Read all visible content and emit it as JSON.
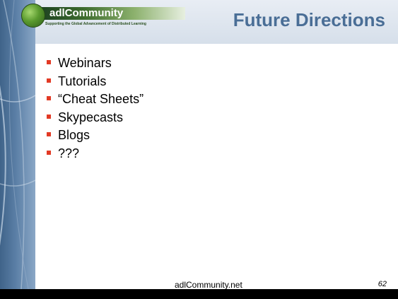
{
  "logo": {
    "name": "adlCommunity",
    "tagline": "Supporting the Global Advancement of Distributed Learning"
  },
  "slide": {
    "title": "Future Directions",
    "bullets": [
      "Webinars",
      "Tutorials",
      "“Cheat Sheets”",
      "Skypecasts",
      "Blogs",
      "???"
    ],
    "footer": "adlCommunity.net",
    "page_number": "62"
  },
  "colors": {
    "title": "#4a6e96",
    "bullet_marker": "#e23a25",
    "left_band": "#5b7fa6",
    "bottom_bar": "#000000"
  }
}
